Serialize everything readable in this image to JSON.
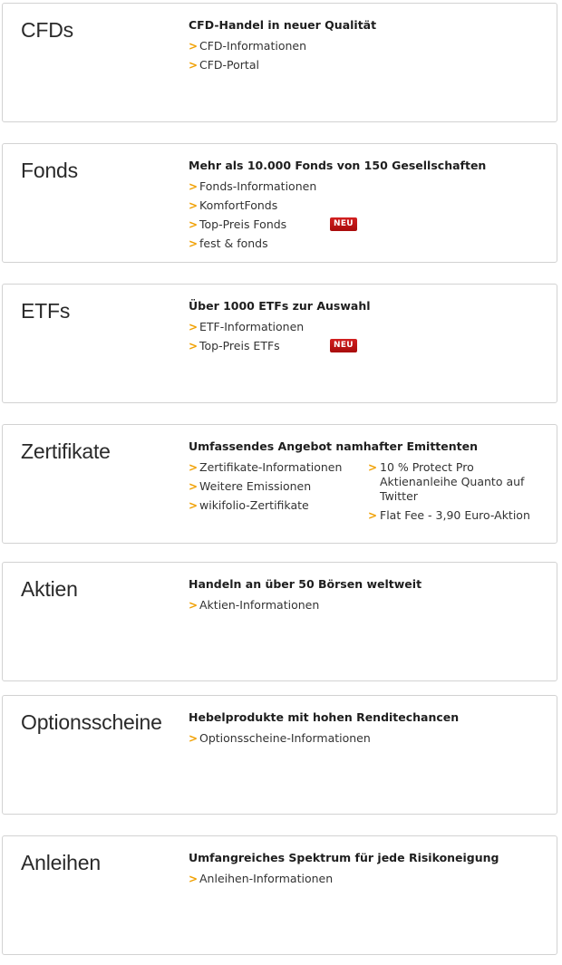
{
  "arrow_glyph": ">",
  "accent_color": "#f0a000",
  "badge_color": "#c01818",
  "panels": [
    {
      "title": "CFDs",
      "headline": "CFD-Handel in neuer Qualität",
      "links": [
        {
          "label": "CFD-Informationen"
        },
        {
          "label": "CFD-Portal"
        }
      ]
    },
    {
      "title": "Fonds",
      "headline": "Mehr als 10.000 Fonds von 150 Gesellschaften",
      "links": [
        {
          "label": "Fonds-Informationen"
        },
        {
          "label": "KomfortFonds"
        },
        {
          "label": "Top-Preis Fonds",
          "badge": "NEU"
        },
        {
          "label": "fest & fonds"
        }
      ]
    },
    {
      "title": "ETFs",
      "headline": "Über 1000 ETFs zur Auswahl",
      "links": [
        {
          "label": "ETF-Informationen"
        },
        {
          "label": "Top-Preis ETFs",
          "badge": "NEU"
        }
      ]
    },
    {
      "title": "Zertifikate",
      "headline": "Umfassendes Angebot namhafter Emittenten",
      "links_left": [
        {
          "label": "Zertifikate-Informationen"
        },
        {
          "label": "Weitere Emissionen"
        },
        {
          "label": "wikifolio-Zertifikate"
        }
      ],
      "links_right": [
        {
          "label": "10 % Protect Pro Aktienanleihe Quanto auf Twitter"
        },
        {
          "label": "Flat Fee - 3,90 Euro-Aktion"
        }
      ]
    },
    {
      "title": "Aktien",
      "headline": "Handeln an über 50 Börsen weltweit",
      "links": [
        {
          "label": "Aktien-Informationen"
        }
      ]
    },
    {
      "title": "Optionsscheine",
      "headline": "Hebelprodukte mit hohen Renditechancen",
      "links": [
        {
          "label": "Optionsscheine-Informationen"
        }
      ]
    },
    {
      "title": "Anleihen",
      "headline": "Umfangreiches Spektrum für jede Risikoneigung",
      "links": [
        {
          "label": "Anleihen-Informationen"
        }
      ]
    }
  ]
}
